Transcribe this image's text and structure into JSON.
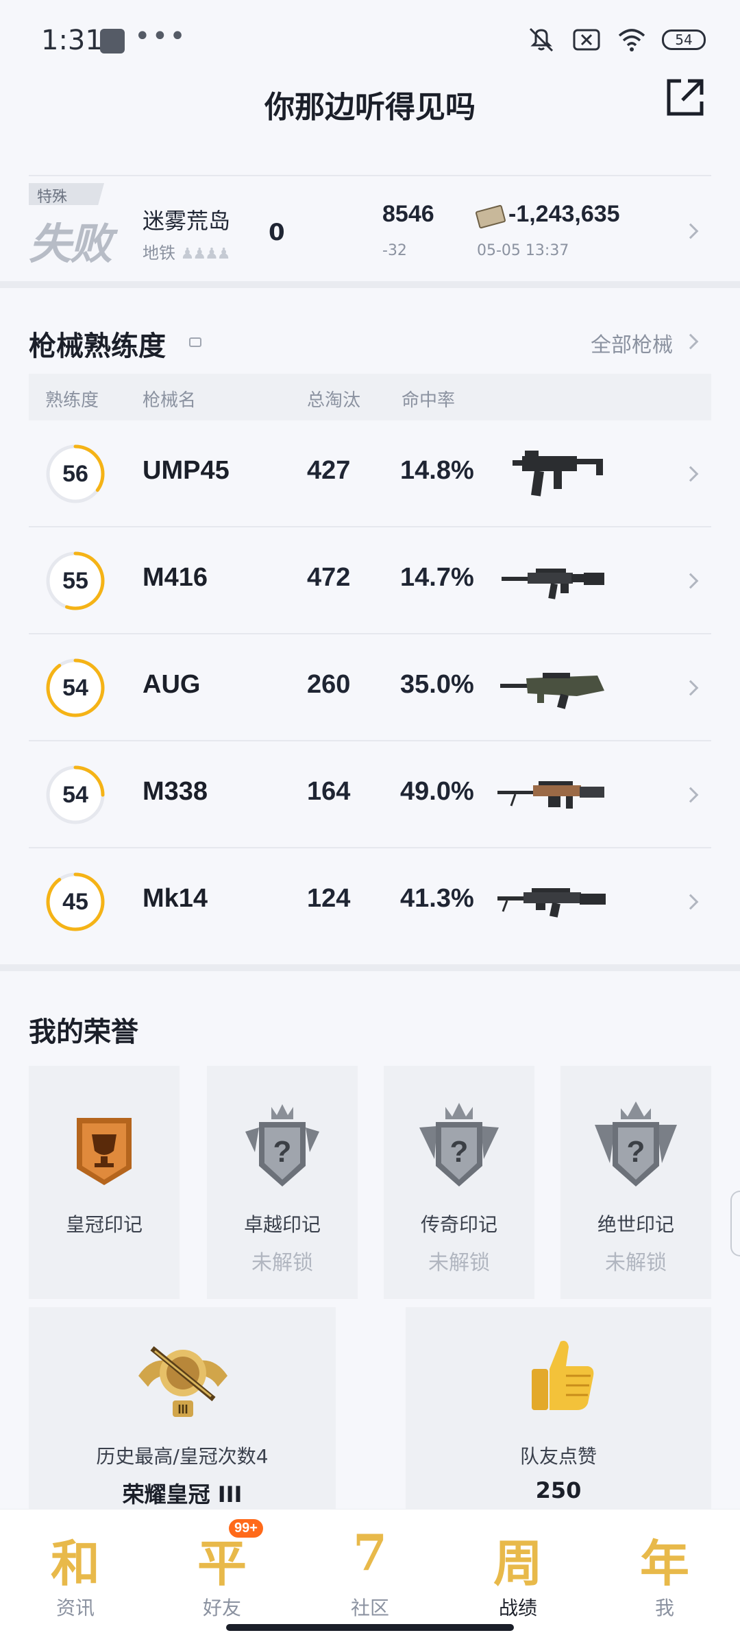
{
  "status_bar": {
    "time": "1:31",
    "dots": "•••",
    "battery": "54"
  },
  "header": {
    "title": "你那边听得见吗"
  },
  "match": {
    "tag": "特殊",
    "result": "失败",
    "map": "迷雾荒岛",
    "mode": "地铁",
    "kills": "0",
    "score": "8546",
    "score_delta": "-32",
    "money": "-1,243,635",
    "time": "05-05 13:37"
  },
  "weapons": {
    "title": "枪械熟练度",
    "all_link": "全部枪械",
    "columns": {
      "proficiency": "熟练度",
      "name": "枪械名",
      "kills": "总淘汰",
      "accuracy": "命中率"
    },
    "rows": [
      {
        "level": "56",
        "name": "UMP45",
        "kills": "427",
        "accuracy": "14.8%",
        "ring_progress": 0.35
      },
      {
        "level": "55",
        "name": "M416",
        "kills": "472",
        "accuracy": "14.7%",
        "ring_progress": 0.55
      },
      {
        "level": "54",
        "name": "AUG",
        "kills": "260",
        "accuracy": "35.0%",
        "ring_progress": 0.9
      },
      {
        "level": "54",
        "name": "M338",
        "kills": "164",
        "accuracy": "49.0%",
        "ring_progress": 0.25
      },
      {
        "level": "45",
        "name": "Mk14",
        "kills": "124",
        "accuracy": "41.3%",
        "ring_progress": 0.9
      }
    ]
  },
  "honors": {
    "title": "我的荣誉",
    "badges": [
      {
        "name": "皇冠印记",
        "status": ""
      },
      {
        "name": "卓越印记",
        "status": "未解锁"
      },
      {
        "name": "传奇印记",
        "status": "未解锁"
      },
      {
        "name": "绝世印记",
        "status": "未解锁"
      }
    ],
    "highest": {
      "label": "历史最高/皇冠次数4",
      "value": "荣耀皇冠 III"
    },
    "likes": {
      "label": "队友点赞",
      "value": "250"
    }
  },
  "bottom_nav": [
    {
      "glyph": "和",
      "label": "资讯"
    },
    {
      "glyph": "平",
      "label": "好友",
      "badge": "99+"
    },
    {
      "glyph": "7",
      "label": "社区"
    },
    {
      "glyph": "周",
      "label": "战绩"
    },
    {
      "glyph": "年",
      "label": "我"
    }
  ],
  "colors": {
    "accent": "#f5b316",
    "ring_track": "#e6e8ee"
  }
}
